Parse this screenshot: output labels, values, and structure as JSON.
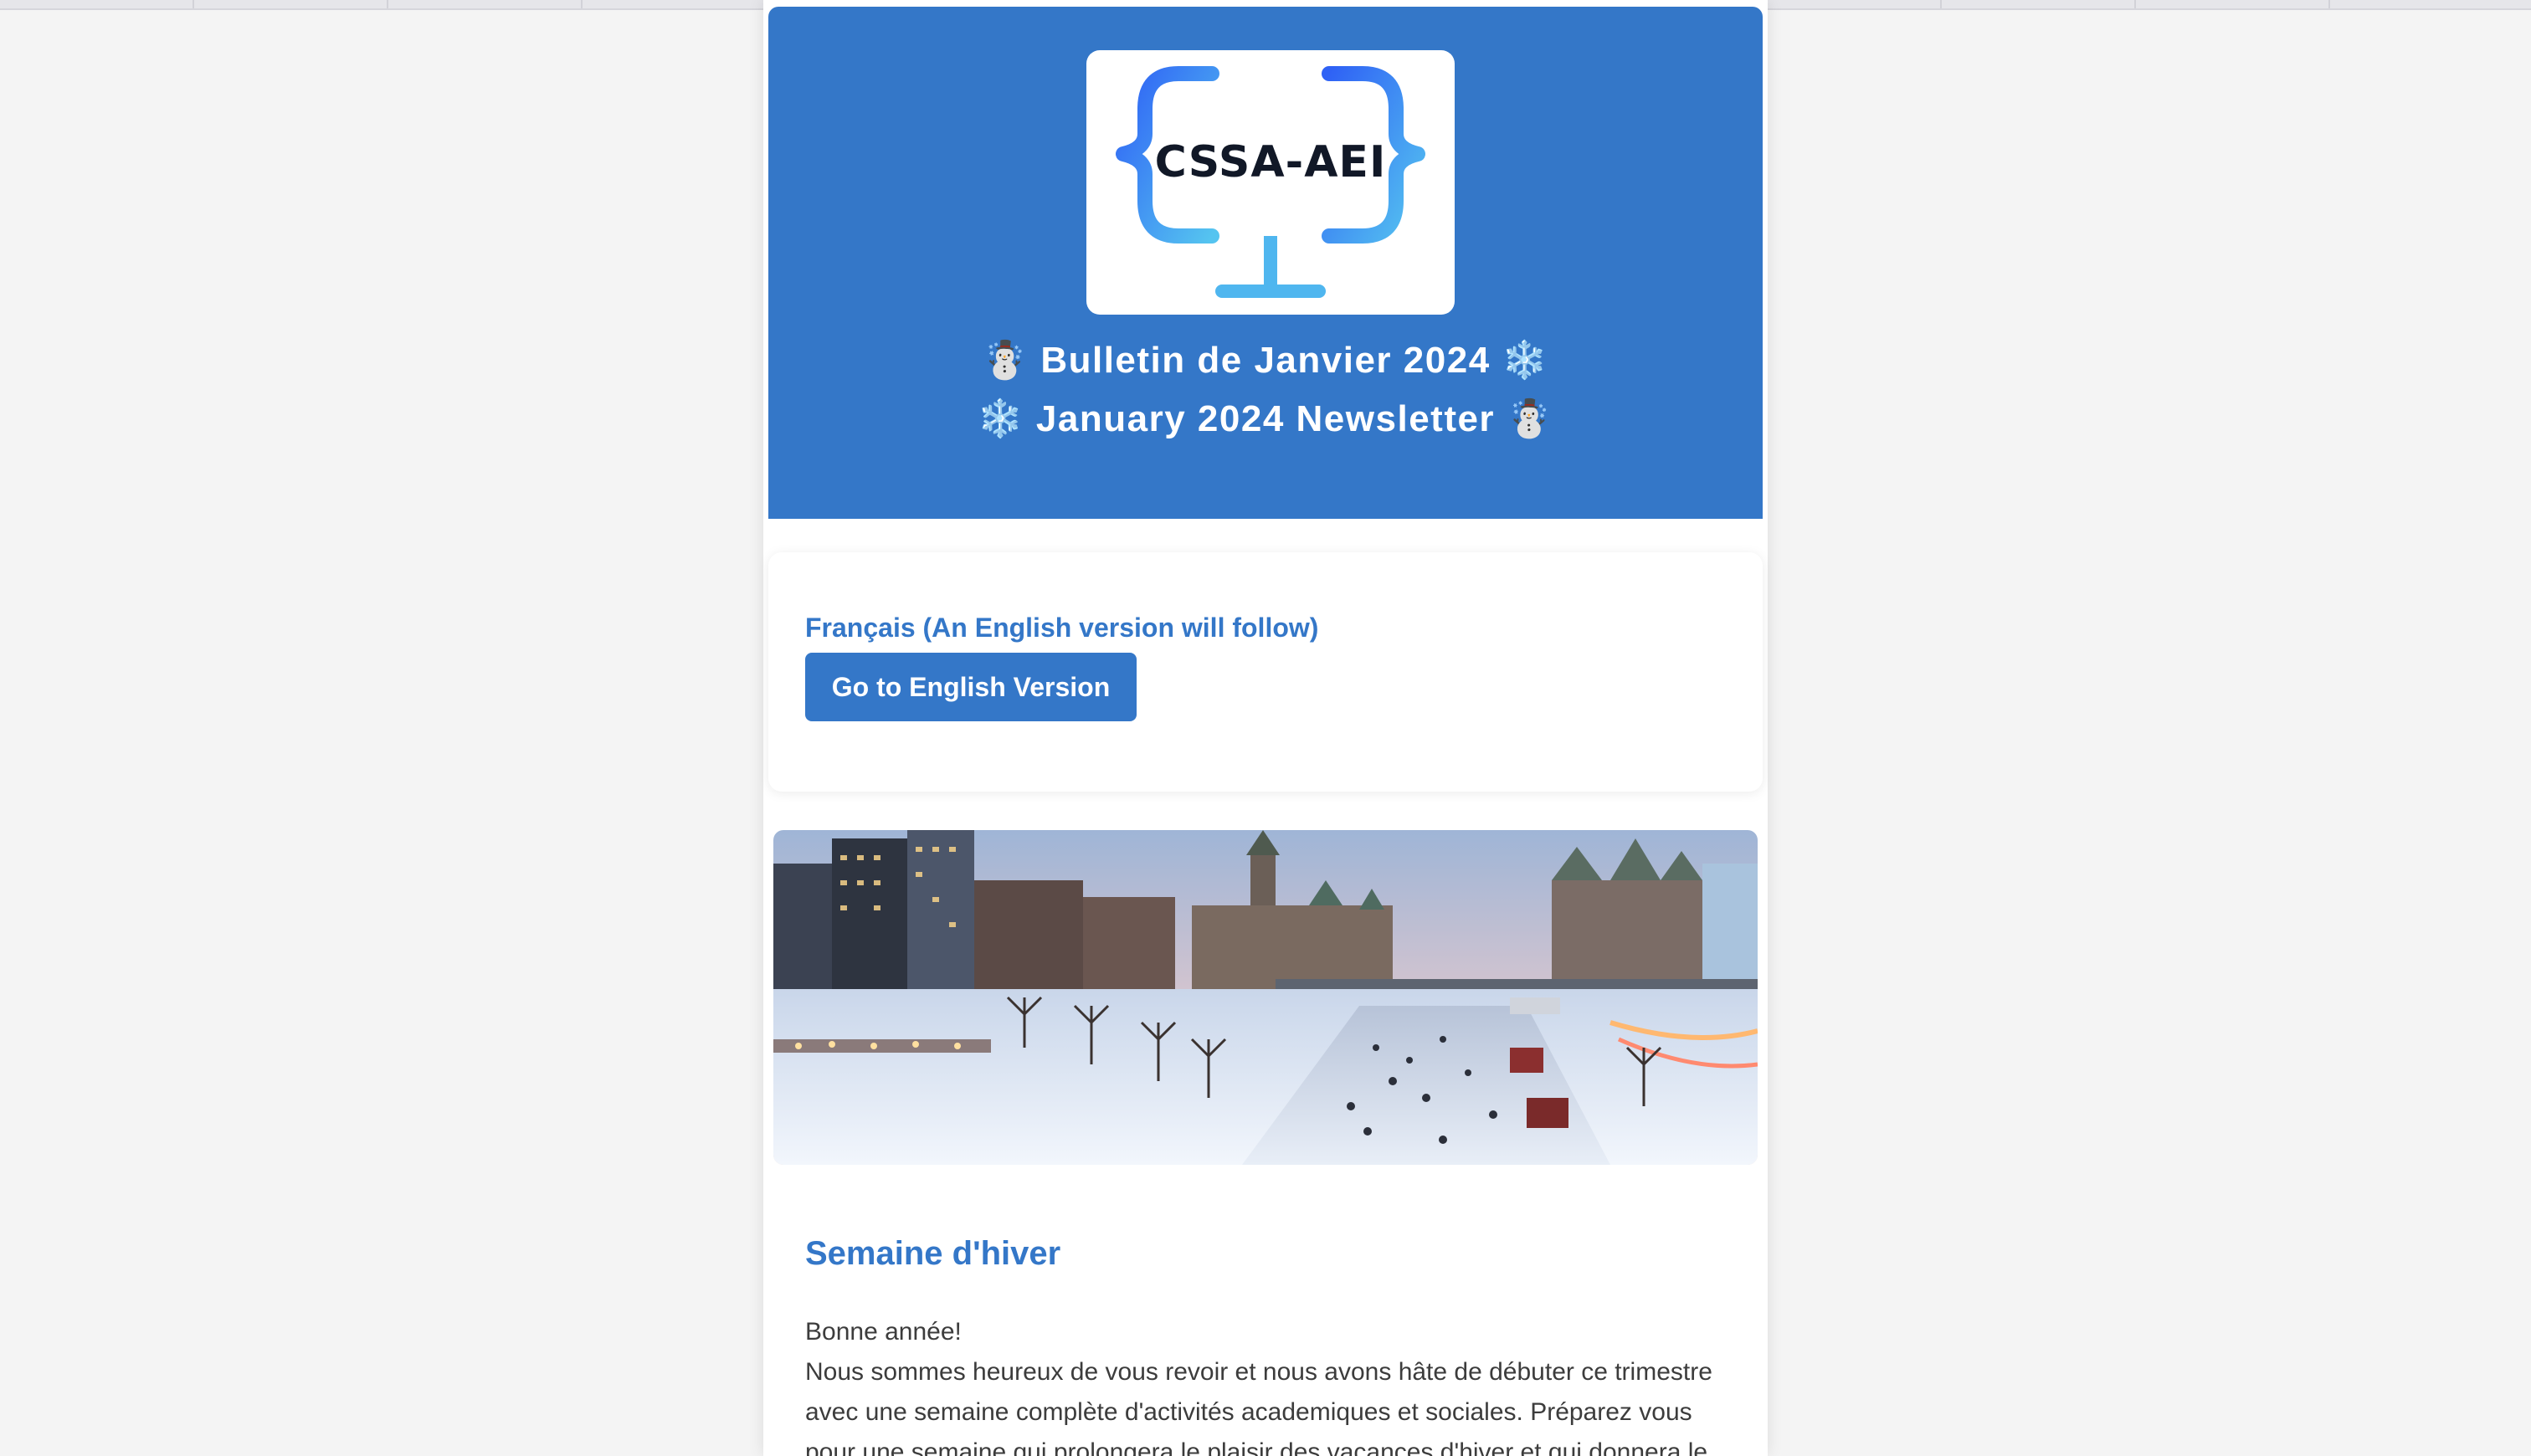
{
  "header": {
    "logo_text": "CSSA-AEI",
    "title_fr": "☃️ Bulletin de Janvier 2024 ❄️",
    "title_en": "❄️ January 2024 Newsletter ☃️",
    "background_color": "#3477c8"
  },
  "language": {
    "note": "Français (An English version will follow)",
    "button_label": "Go to English Version"
  },
  "banner": {
    "alt_subject": "winter-canal-skating-city-image"
  },
  "section": {
    "title": "Semaine d'hiver",
    "greeting": "Bonne année!",
    "paragraph": "Nous sommes heureux de vous revoir et nous avons hâte de débuter ce trimestre avec une semaine complète d'activités academiques et sociales. Préparez vous pour une semaine qui prolongera le plaisir des vacances d'hiver et qui donnera le"
  },
  "colors": {
    "accent": "#3477c8",
    "page_bg": "#f4f4f4",
    "text": "#3c3c3c"
  }
}
